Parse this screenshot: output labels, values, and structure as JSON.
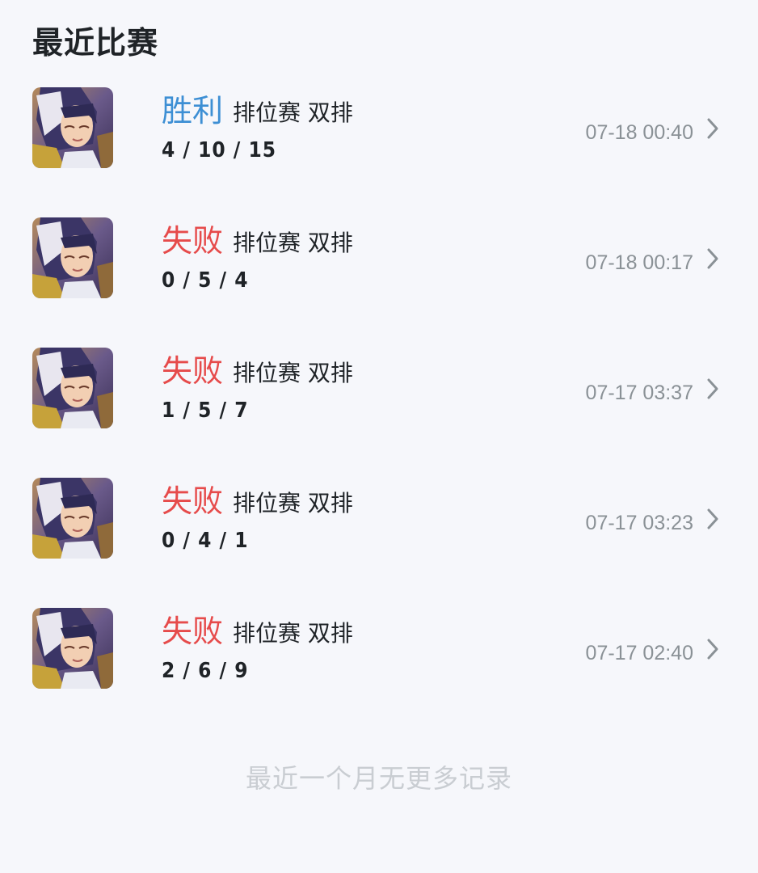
{
  "header": {
    "title": "最近比赛"
  },
  "matches": [
    {
      "result": "胜利",
      "outcome": "win",
      "mode": "排位赛 双排",
      "kda": "4 / 10 / 15",
      "time": "07-18 00:40"
    },
    {
      "result": "失败",
      "outcome": "lose",
      "mode": "排位赛 双排",
      "kda": "0 / 5 / 4",
      "time": "07-18 00:17"
    },
    {
      "result": "失败",
      "outcome": "lose",
      "mode": "排位赛 双排",
      "kda": "1 / 5 / 7",
      "time": "07-17 03:37"
    },
    {
      "result": "失败",
      "outcome": "lose",
      "mode": "排位赛 双排",
      "kda": "0 / 4 / 1",
      "time": "07-17 03:23"
    },
    {
      "result": "失败",
      "outcome": "lose",
      "mode": "排位赛 双排",
      "kda": "2 / 6 / 9",
      "time": "07-17 02:40"
    }
  ],
  "footer": {
    "note": "最近一个月无更多记录"
  },
  "colors": {
    "win": "#3d8fd4",
    "lose": "#e64b4b",
    "text": "#1f2327",
    "muted": "#8a9196"
  },
  "icons": {
    "row_arrow": "chevron-right-icon",
    "avatar": "hero-portrait"
  }
}
